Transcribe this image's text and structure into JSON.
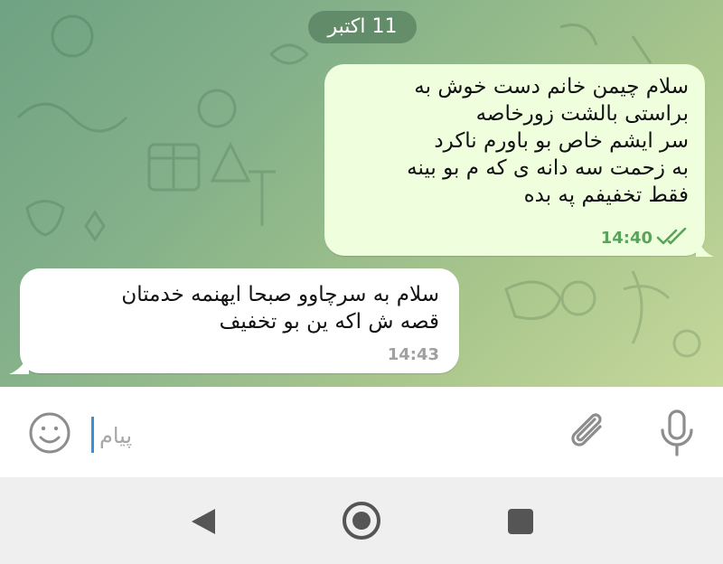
{
  "chat": {
    "date_label": "11 اکتبر",
    "messages": [
      {
        "direction": "outgoing",
        "text": "سلام چیمن خانم دست خوش به\nبراستی بالشت زورخاصه\nسر ایشم خاص بو باورم ناکرد\nبه زحمت سه دانه ی که م بو بینه\nفقط تخفیفم په بده",
        "time": "14:40",
        "status": "read"
      },
      {
        "direction": "incoming",
        "text": "سلام به سرچاوو صبحا ایهنمه خدمتان\nقصه ش اکه ین بو تخفیف",
        "time": "14:43"
      }
    ]
  },
  "composer": {
    "placeholder": "پیام",
    "value": "",
    "icons": {
      "emoji": "smiley-icon",
      "attach": "paperclip-icon",
      "mic": "microphone-icon"
    }
  },
  "navigation": {
    "icons": [
      "back-triangle-icon",
      "home-circle-icon",
      "recent-square-icon"
    ]
  },
  "colors": {
    "outgoing_bubble": "#efffde",
    "incoming_bubble": "#ffffff",
    "read_check": "#5aa35a",
    "cursor": "#3b8fd8"
  }
}
